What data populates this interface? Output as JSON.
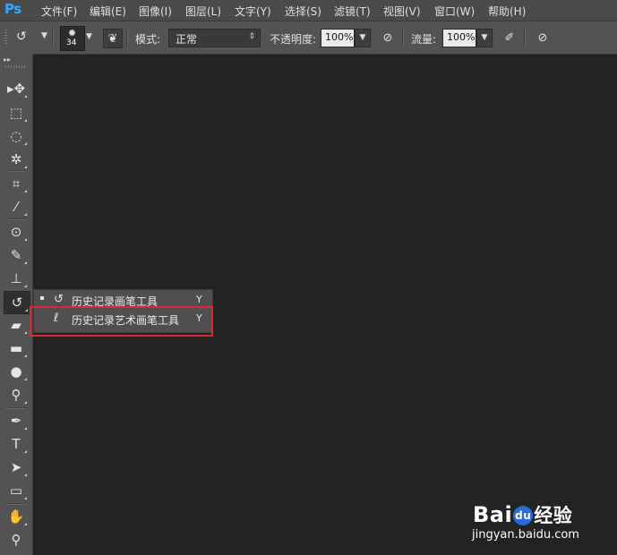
{
  "app": {
    "logo": "Ps"
  },
  "menu": [
    {
      "label": "文件(F)"
    },
    {
      "label": "编辑(E)"
    },
    {
      "label": "图像(I)"
    },
    {
      "label": "图层(L)"
    },
    {
      "label": "文字(Y)"
    },
    {
      "label": "选择(S)"
    },
    {
      "label": "滤镜(T)"
    },
    {
      "label": "视图(V)"
    },
    {
      "label": "窗口(W)"
    },
    {
      "label": "帮助(H)"
    }
  ],
  "options": {
    "brush_size": "34",
    "mode_label": "模式:",
    "mode_value": "正常",
    "opacity_label": "不透明度:",
    "opacity_value": "100%",
    "flow_label": "流量:",
    "flow_value": "100%"
  },
  "toolbar": {
    "tools": [
      {
        "name": "move-tool",
        "icon": "move-icon",
        "glyph": "▸✥"
      },
      {
        "name": "marquee-tool",
        "icon": "rect-marquee-icon",
        "glyph": "⬚"
      },
      {
        "name": "lasso-tool",
        "icon": "lasso-icon",
        "glyph": "ᴑ"
      },
      {
        "name": "magic-wand-tool",
        "icon": "magic-wand-icon",
        "glyph": "✲"
      },
      {
        "name": "crop-tool",
        "icon": "crop-icon",
        "glyph": "⌗"
      },
      {
        "name": "eyedropper-tool",
        "icon": "eyedropper-icon",
        "glyph": "⁄"
      },
      {
        "name": "spot-healing-tool",
        "icon": "spot-healing-icon",
        "glyph": "⊙"
      },
      {
        "name": "brush-tool",
        "icon": "brush-icon",
        "glyph": "✎"
      },
      {
        "name": "clone-stamp-tool",
        "icon": "stamp-icon",
        "glyph": "⊥"
      },
      {
        "name": "history-brush-tool",
        "icon": "history-brush-icon",
        "glyph": "↺"
      },
      {
        "name": "eraser-tool",
        "icon": "eraser-icon",
        "glyph": "▰"
      },
      {
        "name": "gradient-tool",
        "icon": "gradient-icon",
        "glyph": "▬"
      },
      {
        "name": "blur-tool",
        "icon": "blur-drop-icon",
        "glyph": "●"
      },
      {
        "name": "dodge-tool",
        "icon": "dodge-icon",
        "glyph": "⚲"
      },
      {
        "name": "pen-tool",
        "icon": "pen-icon",
        "glyph": "✒"
      },
      {
        "name": "type-tool",
        "icon": "type-icon",
        "glyph": "T"
      },
      {
        "name": "path-selection-tool",
        "icon": "path-select-icon",
        "glyph": "➤"
      },
      {
        "name": "rectangle-tool",
        "icon": "rectangle-icon",
        "glyph": "▭"
      },
      {
        "name": "hand-tool",
        "icon": "hand-icon",
        "glyph": "✋"
      },
      {
        "name": "zoom-tool",
        "icon": "zoom-icon",
        "glyph": "⚲"
      }
    ]
  },
  "flyout": {
    "items": [
      {
        "label": "历史记录画笔工具",
        "shortcut": "Y",
        "icon": "history-brush-icon",
        "selected": true
      },
      {
        "label": "历史记录艺术画笔工具",
        "shortcut": "Y",
        "icon": "art-history-brush-icon",
        "selected": false
      }
    ]
  },
  "watermark": {
    "logo_a": "Bai",
    "logo_paw": "du",
    "logo_cn": "经验",
    "url": "jingyan.baidu.com"
  },
  "colors": {
    "canvas": "#232323",
    "panel": "#535353",
    "menubar": "#4a4a4a",
    "highlight": "#e0262e",
    "logo": "#31a8ff"
  }
}
